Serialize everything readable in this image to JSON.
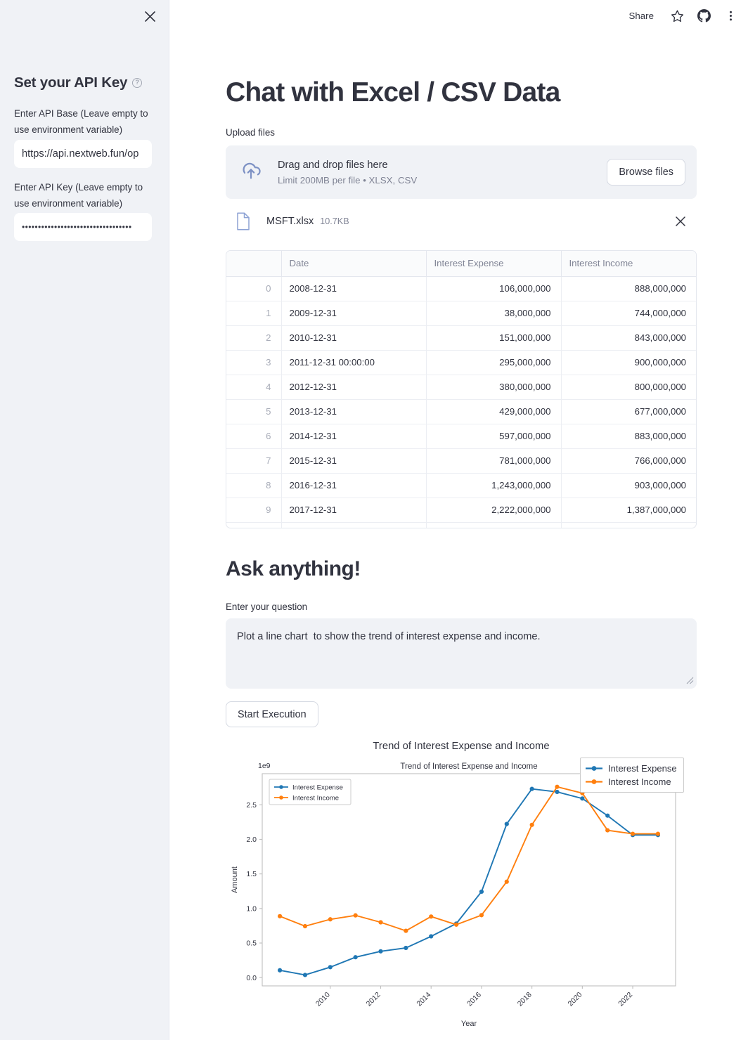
{
  "sidebar": {
    "close_icon": "close-icon",
    "title": "Set your API Key",
    "help_icon": "help-circle-icon",
    "api_base_label": "Enter API Base (Leave empty to use environment variable)",
    "api_base_value": "https://api.nextweb.fun/op",
    "api_key_label": "Enter API Key (Leave empty to use environment variable)",
    "api_key_value": "••••••••••••••••••••••••••••••••••"
  },
  "header": {
    "share_label": "Share",
    "star_icon": "star-icon",
    "github_icon": "github-icon",
    "menu_icon": "three-dots-menu-icon"
  },
  "main": {
    "page_title": "Chat with Excel / CSV Data",
    "upload_label": "Upload files",
    "dropzone": {
      "cloud_icon": "cloud-upload-icon",
      "primary": "Drag and drop files here",
      "secondary": "Limit 200MB per file • XLSX, CSV",
      "browse_label": "Browse files"
    },
    "file": {
      "doc_icon": "document-icon",
      "name": "MSFT.xlsx",
      "size": "10.7KB",
      "remove_icon": "close-icon"
    },
    "table": {
      "columns": [
        "",
        "Date",
        "Interest Expense",
        "Interest Income"
      ],
      "rows": [
        [
          "0",
          "2008-12-31",
          "106,000,000",
          "888,000,000"
        ],
        [
          "1",
          "2009-12-31",
          "38,000,000",
          "744,000,000"
        ],
        [
          "2",
          "2010-12-31",
          "151,000,000",
          "843,000,000"
        ],
        [
          "3",
          "2011-12-31 00:00:00",
          "295,000,000",
          "900,000,000"
        ],
        [
          "4",
          "2012-12-31",
          "380,000,000",
          "800,000,000"
        ],
        [
          "5",
          "2013-12-31",
          "429,000,000",
          "677,000,000"
        ],
        [
          "6",
          "2014-12-31",
          "597,000,000",
          "883,000,000"
        ],
        [
          "7",
          "2015-12-31",
          "781,000,000",
          "766,000,000"
        ],
        [
          "8",
          "2016-12-31",
          "1,243,000,000",
          "903,000,000"
        ],
        [
          "9",
          "2017-12-31",
          "2,222,000,000",
          "1,387,000,000"
        ],
        [
          "",
          "",
          "",
          ""
        ]
      ]
    },
    "ask_title": "Ask anything!",
    "question_label": "Enter your question",
    "question_value": "Plot a line chart  to show the trend of interest expense and income.",
    "question_placeholder": "",
    "execute_label": "Start Execution"
  },
  "chart_data": {
    "type": "line",
    "title": "Trend of Interest Expense and Income",
    "inner_title": "Trend of Interest Expense and Income",
    "xlabel": "Year",
    "ylabel": "Amount",
    "y_offset_text": "1e9",
    "grid": false,
    "legend_position": "upper left",
    "outer_legend_position": "upper right",
    "xlim": [
      2007.3,
      2023.7
    ],
    "ylim": [
      -0.12,
      2.95
    ],
    "xticks": [
      "2010",
      "2012",
      "2014",
      "2016",
      "2018",
      "2020",
      "2022"
    ],
    "xtick_values": [
      2010,
      2012,
      2014,
      2016,
      2018,
      2020,
      2022
    ],
    "yticks": [
      "0.0",
      "0.5",
      "1.0",
      "1.5",
      "2.0",
      "2.5"
    ],
    "ytick_values": [
      0.0,
      0.5,
      1.0,
      1.5,
      2.0,
      2.5
    ],
    "x": [
      2008,
      2009,
      2010,
      2011,
      2012,
      2013,
      2014,
      2015,
      2016,
      2017,
      2018,
      2019,
      2020,
      2021,
      2022,
      2023
    ],
    "series": [
      {
        "name": "Interest Expense",
        "color": "#1f77b4",
        "values": [
          0.106,
          0.038,
          0.151,
          0.295,
          0.38,
          0.429,
          0.597,
          0.781,
          1.243,
          2.222,
          2.73,
          2.686,
          2.591,
          2.343,
          2.063,
          2.063
        ]
      },
      {
        "name": "Interest Income",
        "color": "#ff7f0e",
        "values": [
          0.888,
          0.744,
          0.843,
          0.9,
          0.8,
          0.677,
          0.883,
          0.766,
          0.903,
          1.387,
          2.21,
          2.76,
          2.668,
          2.131,
          2.08,
          2.08
        ]
      }
    ]
  }
}
